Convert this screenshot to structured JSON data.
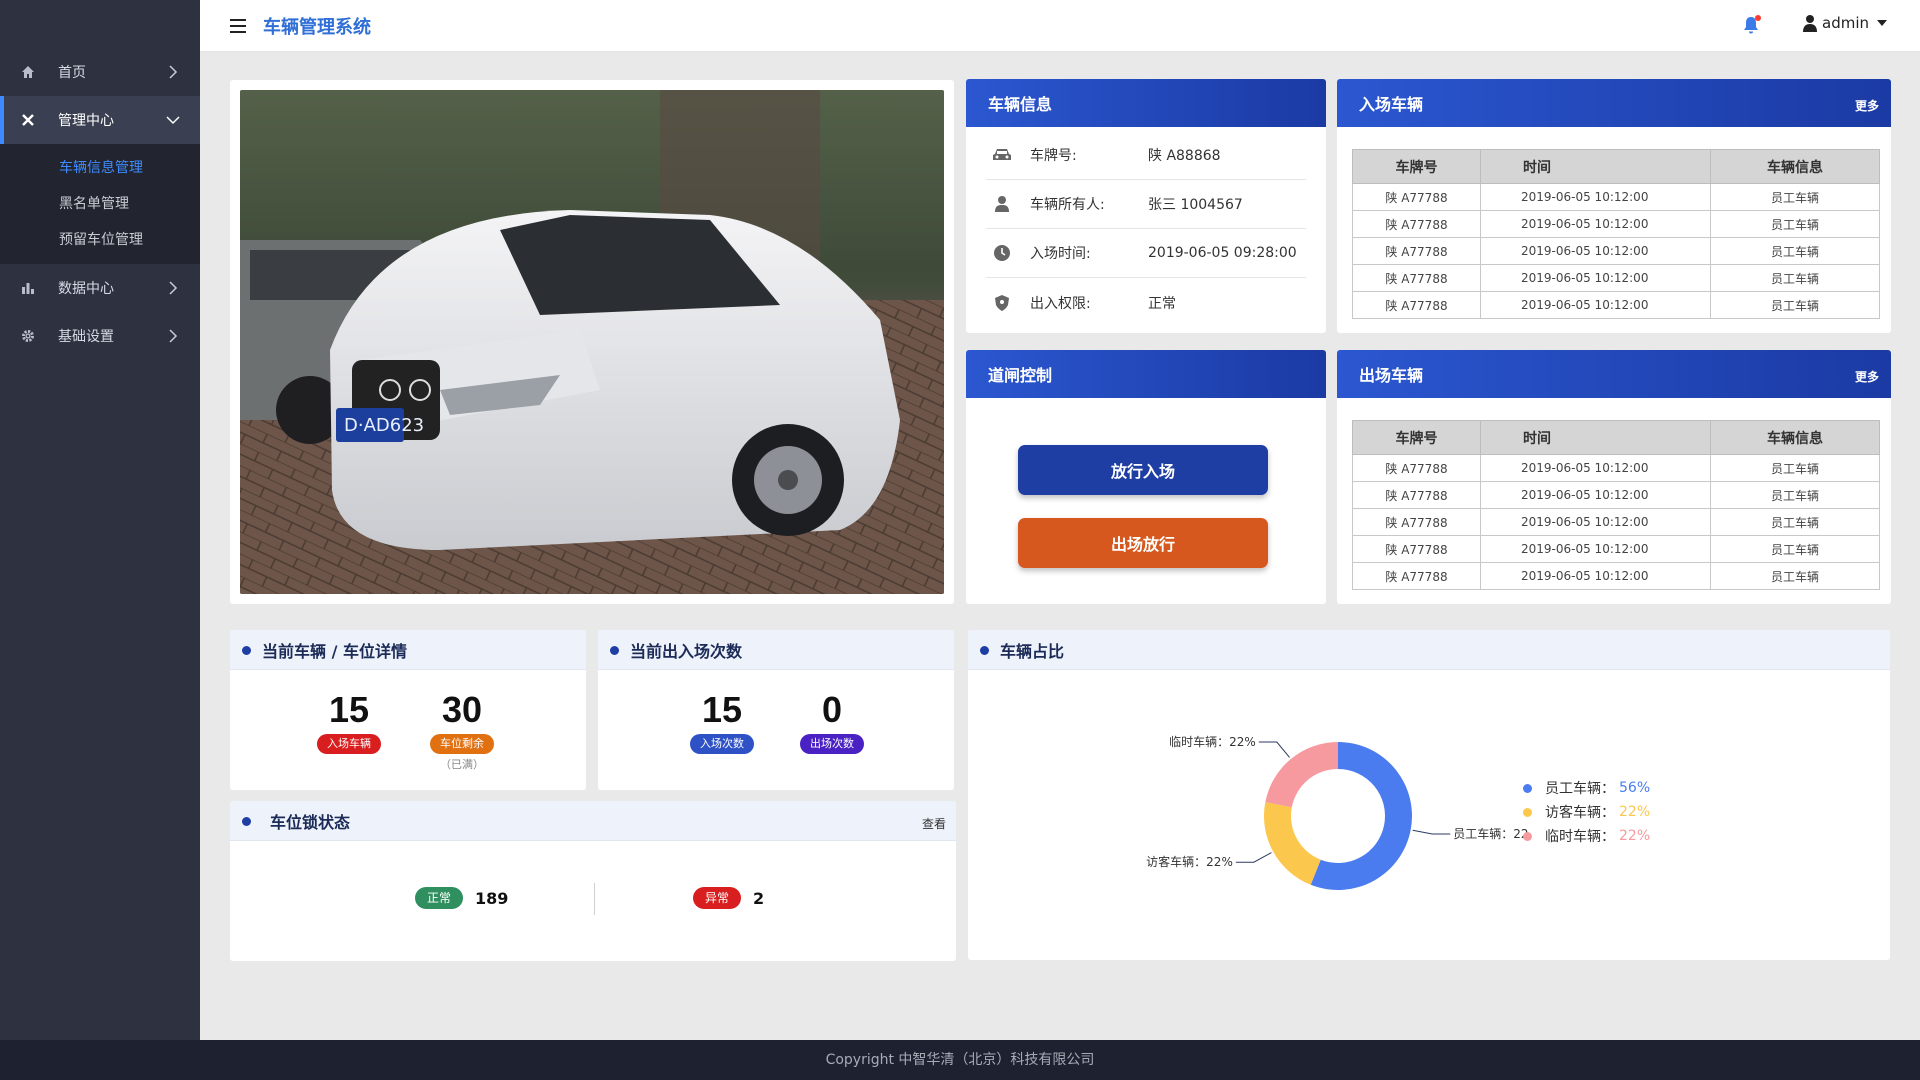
{
  "app": {
    "title": "车辆管理系统",
    "user": "admin"
  },
  "sidebar": {
    "items": [
      {
        "label": "首页",
        "icon": "home-icon"
      },
      {
        "label": "管理中心",
        "icon": "tools-icon"
      },
      {
        "label": "数据中心",
        "icon": "bar-chart-icon"
      },
      {
        "label": "基础设置",
        "icon": "gear-icon"
      }
    ],
    "submenu": [
      {
        "label": "车辆信息管理"
      },
      {
        "label": "黑名单管理"
      },
      {
        "label": "预留车位管理"
      }
    ]
  },
  "vehicle_info": {
    "title": "车辆信息",
    "rows": [
      {
        "label": "车牌号:",
        "value": "陕 A88868"
      },
      {
        "label": "车辆所有人:",
        "value": "张三 1004567"
      },
      {
        "label": "入场时间:",
        "value": "2019-06-05  09:28:00"
      },
      {
        "label": "出入权限:",
        "value": "正常"
      }
    ]
  },
  "gate": {
    "title": "道闸控制",
    "btn_in": "放行入场",
    "btn_out": "出场放行"
  },
  "entry": {
    "title": "入场车辆",
    "more": "更多",
    "headers": [
      "车牌号",
      "时间",
      "车辆信息"
    ],
    "rows": [
      [
        "陕 A77788",
        "2019-06-05 10:12:00",
        "员工车辆"
      ],
      [
        "陕 A77788",
        "2019-06-05 10:12:00",
        "员工车辆"
      ],
      [
        "陕 A77788",
        "2019-06-05 10:12:00",
        "员工车辆"
      ],
      [
        "陕 A77788",
        "2019-06-05 10:12:00",
        "员工车辆"
      ],
      [
        "陕 A77788",
        "2019-06-05 10:12:00",
        "员工车辆"
      ]
    ]
  },
  "exit": {
    "title": "出场车辆",
    "more": "更多",
    "headers": [
      "车牌号",
      "时间",
      "车辆信息"
    ],
    "rows": [
      [
        "陕 A77788",
        "2019-06-05 10:12:00",
        "员工车辆"
      ],
      [
        "陕 A77788",
        "2019-06-05 10:12:00",
        "员工车辆"
      ],
      [
        "陕 A77788",
        "2019-06-05 10:12:00",
        "员工车辆"
      ],
      [
        "陕 A77788",
        "2019-06-05 10:12:00",
        "员工车辆"
      ],
      [
        "陕 A77788",
        "2019-06-05 10:12:00",
        "员工车辆"
      ]
    ]
  },
  "current": {
    "title": "当前车辆 / 车位详情",
    "vehicles": "15",
    "vehicles_label": "入场车辆",
    "spaces": "30",
    "spaces_label": "车位剩余",
    "spaces_note": "（已满）"
  },
  "traffic": {
    "title": "当前出入场次数",
    "in": "15",
    "in_label": "入场次数",
    "out": "0",
    "out_label": "出场次数"
  },
  "locks": {
    "title": "车位锁状态",
    "view": "查看",
    "normal_label": "正常",
    "normal_count": "189",
    "abnormal_label": "异常",
    "abnormal_count": "2"
  },
  "ratio": {
    "title": "车辆占比",
    "legend": [
      {
        "name": "员工车辆：",
        "value": "56%"
      },
      {
        "name": "访客车辆：",
        "value": "22%"
      },
      {
        "name": "临时车辆：",
        "value": "22%"
      }
    ]
  },
  "chart_data": {
    "type": "pie",
    "title": "车辆占比",
    "donut": true,
    "series": [
      {
        "name": "员工车辆",
        "value": 56,
        "label": "员工车辆：22%",
        "color": "#4a7cf0"
      },
      {
        "name": "访客车辆",
        "value": 22,
        "label": "访客车辆：22%",
        "color": "#fcc74d"
      },
      {
        "name": "临时车辆",
        "value": 22,
        "label": "临时车辆：22%",
        "color": "#f79a9f"
      }
    ]
  },
  "colors": {
    "accent": "#2f6fd6",
    "sidebar": "#2d3140",
    "head_blue": "#1e3ea3",
    "btn_orange": "#d6581e",
    "pill_red": "#d81e1e",
    "pill_orange": "#e07010",
    "pill_blue": "#2e52c6",
    "pill_purple": "#4a22c3",
    "pill_green": "#2f8f5f"
  },
  "footer": {
    "text": "Copyright 中智华清（北京）科技有限公司"
  }
}
